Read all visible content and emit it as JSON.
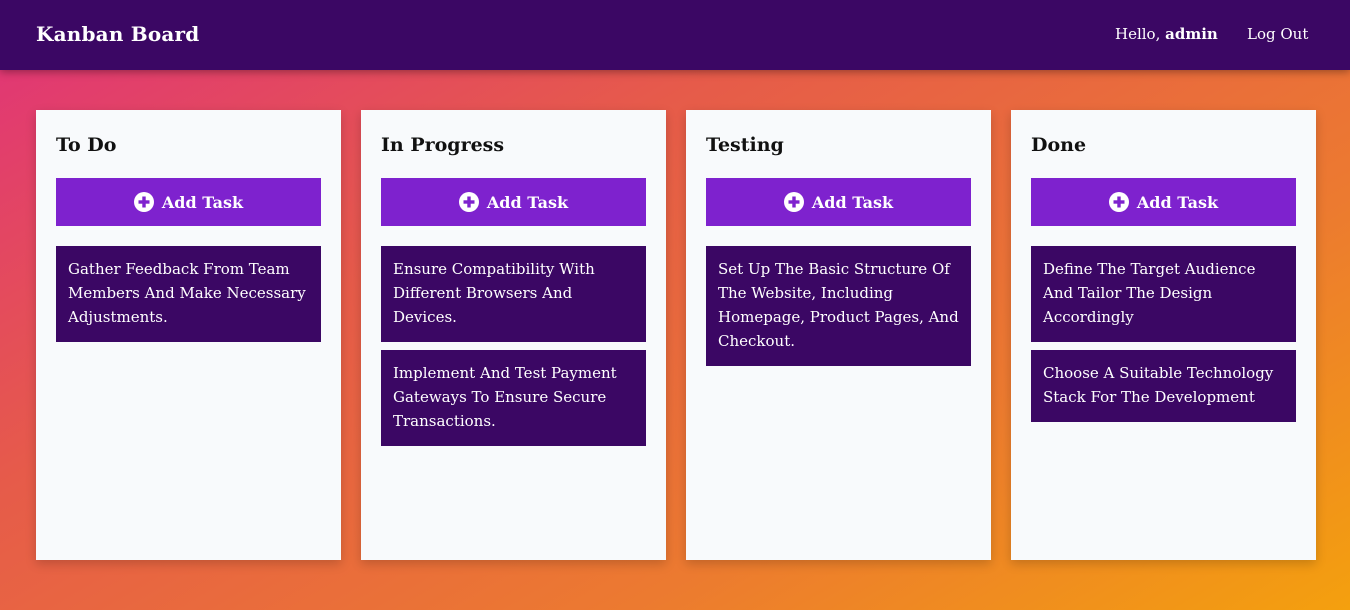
{
  "header": {
    "title": "Kanban Board",
    "greeting_prefix": "Hello, ",
    "username": "admin",
    "logout_label": "Log Out"
  },
  "add_task_label": "Add Task",
  "columns": [
    {
      "title": "To Do",
      "tasks": [
        "Gather Feedback From Team Members And Make Necessary Adjustments."
      ]
    },
    {
      "title": "In Progress",
      "tasks": [
        "Ensure Compatibility With Different Browsers And Devices.",
        "Implement And Test Payment Gateways To Ensure Secure Transactions."
      ]
    },
    {
      "title": "Testing",
      "tasks": [
        "Set Up The Basic Structure Of The Website, Including Homepage, Product Pages, And Checkout."
      ]
    },
    {
      "title": "Done",
      "tasks": [
        "Define The Target Audience And Tailor The Design Accordingly",
        "Choose A Suitable Technology Stack For The Development"
      ]
    }
  ],
  "colors": {
    "navbar": "#3b0764",
    "accent": "#7e22ce",
    "task_card": "#3b0764",
    "column_bg": "#f8fafc"
  },
  "icons": {
    "add_task": "plus-circle-icon"
  }
}
